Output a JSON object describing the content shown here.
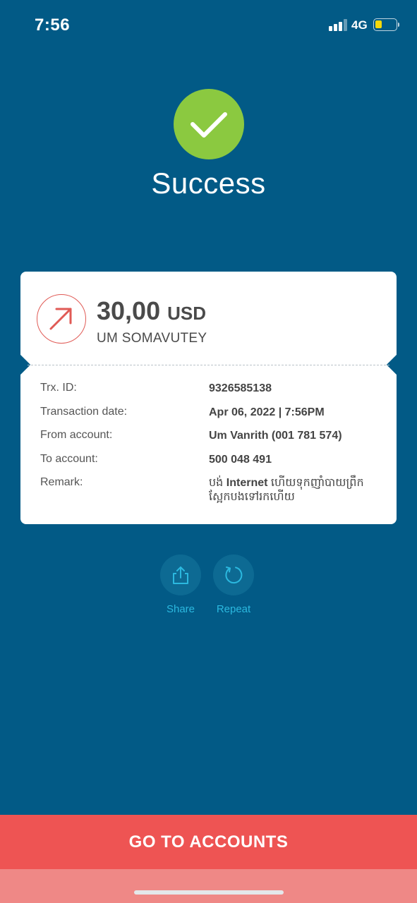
{
  "status_bar": {
    "time": "7:56",
    "network": "4G",
    "battery_color": "#f5d90a"
  },
  "result": {
    "title": "Success",
    "icon": "checkmark-icon",
    "color": "#8bc940"
  },
  "transaction": {
    "amount": "30,00",
    "currency": "USD",
    "recipient": "UM SOMAVUTEY",
    "direction_icon": "outgoing-arrow-icon",
    "details": [
      {
        "label": "Trx. ID:",
        "value": "9326585138"
      },
      {
        "label": "Transaction date:",
        "value": "Apr 06, 2022 | 7:56PM"
      },
      {
        "label": "From account:",
        "value": "Um Vanrith (001 781 574)"
      },
      {
        "label": "To account:",
        "value": "500 048 491"
      }
    ],
    "remark": {
      "label": "Remark:",
      "prefix": "បង់ ",
      "bold": "Internet",
      "suffix": " ហើយទុកញាំបាយព្រឹកស្អែកបងទៅរកហើយ"
    }
  },
  "actions": {
    "share": {
      "label": "Share",
      "icon": "share-icon"
    },
    "repeat": {
      "label": "Repeat",
      "icon": "repeat-icon"
    }
  },
  "primary_button": {
    "label": "GO TO ACCOUNTS",
    "color": "#ee5453"
  },
  "colors": {
    "background": "#025a86",
    "accent": "#2bb8df",
    "danger": "#e05a55"
  }
}
